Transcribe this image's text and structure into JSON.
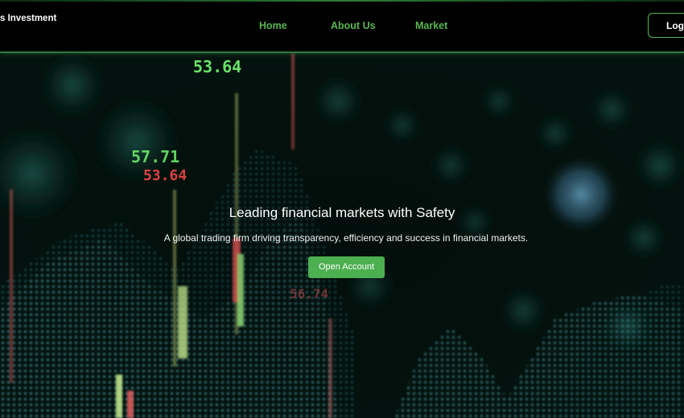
{
  "navbar": {
    "brand": "s Investment",
    "links": [
      "Home",
      "About Us",
      "Market"
    ],
    "login_label": "Log"
  },
  "hero": {
    "title": "Leading financial markets with Safety",
    "subtitle": "A global trading firm driving transparency, efficiency and success in financial markets.",
    "cta_label": "Open Account",
    "tickers": [
      "53.64",
      "57.71",
      "53.64",
      "56.74"
    ]
  },
  "colors": {
    "accent": "#4caf50",
    "nav_link": "#57b64e",
    "background": "#000000"
  }
}
